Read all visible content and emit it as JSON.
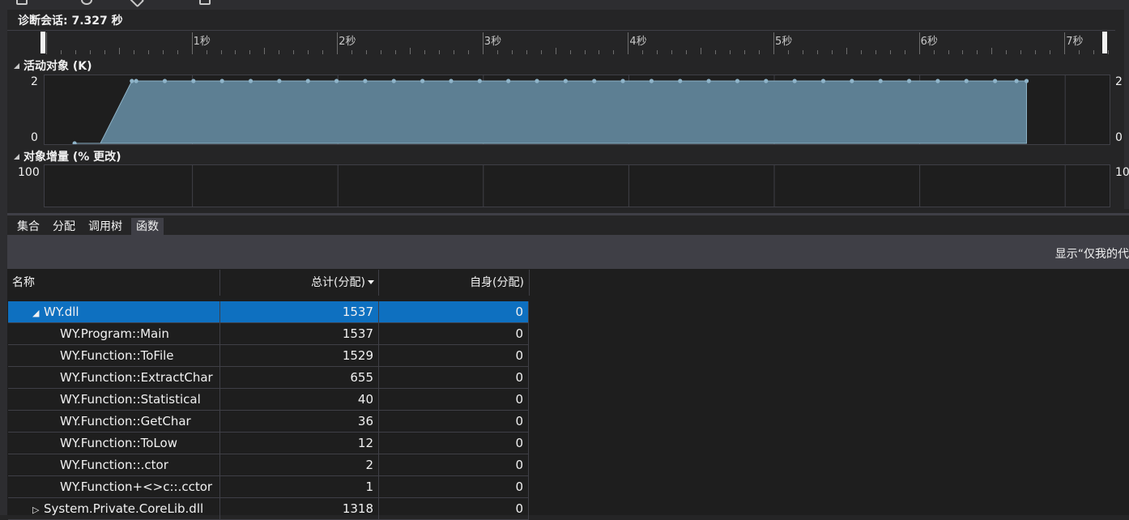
{
  "session": {
    "title": "诊断会话: 7.327 秒"
  },
  "ruler": {
    "labels": [
      "1秒",
      "2秒",
      "3秒",
      "4秒",
      "5秒",
      "6秒",
      "7秒"
    ]
  },
  "live_objects": {
    "title": "活动对象 (K)",
    "y_max_label": "2",
    "y_min_label": "0",
    "y_max_label_right": "2",
    "y_min_label_right": "0"
  },
  "object_diff": {
    "title": "对象增量 (% 更改)",
    "y_max_label": "100",
    "y_max_label_right": "10"
  },
  "tabs": [
    {
      "label": "集合",
      "active": false
    },
    {
      "label": "分配",
      "active": false
    },
    {
      "label": "调用树",
      "active": false
    },
    {
      "label": "函数",
      "active": true
    }
  ],
  "filter": {
    "label": "显示“仅我的代"
  },
  "table": {
    "headers": {
      "name": "名称",
      "total": "总计(分配)",
      "self": "自身(分配)"
    },
    "rows": [
      {
        "name": "WY.dll",
        "total": "1537",
        "self": "0",
        "level": 0,
        "expander": "◢",
        "selected": true
      },
      {
        "name": "WY.Program::Main",
        "total": "1537",
        "self": "0",
        "level": 1
      },
      {
        "name": "WY.Function::ToFile",
        "total": "1529",
        "self": "0",
        "level": 1
      },
      {
        "name": "WY.Function::ExtractChar",
        "total": "655",
        "self": "0",
        "level": 1
      },
      {
        "name": "WY.Function::Statistical",
        "total": "40",
        "self": "0",
        "level": 1
      },
      {
        "name": "WY.Function::GetChar",
        "total": "36",
        "self": "0",
        "level": 1
      },
      {
        "name": "WY.Function::ToLow",
        "total": "12",
        "self": "0",
        "level": 1
      },
      {
        "name": "WY.Function::.ctor",
        "total": "2",
        "self": "0",
        "level": 1
      },
      {
        "name": "WY.Function+<>c::.cctor",
        "total": "1",
        "self": "0",
        "level": 1
      },
      {
        "name": "System.Private.CoreLib.dll",
        "total": "1318",
        "self": "0",
        "level": 0,
        "expander": "▷"
      }
    ]
  },
  "chart_data": {
    "type": "area",
    "title": "活动对象 (K)",
    "xlabel": "",
    "ylabel": "",
    "x": [
      0.07,
      0.25,
      0.47,
      0.5,
      0.7,
      0.9,
      1.1,
      1.3,
      1.5,
      1.7,
      1.9,
      2.1,
      2.3,
      2.5,
      2.7,
      2.9,
      3.1,
      3.3,
      3.5,
      3.7,
      3.9,
      4.1,
      4.3,
      4.5,
      4.7,
      4.9,
      5.1,
      5.3,
      5.5,
      5.7,
      5.9,
      6.1,
      6.3,
      6.5,
      6.65,
      6.72
    ],
    "series": [
      {
        "values": [
          0,
          0,
          2,
          2,
          2,
          2,
          2,
          2,
          2,
          2,
          2,
          2,
          2,
          2,
          2,
          2,
          2,
          2,
          2,
          2,
          2,
          2,
          2,
          2,
          2,
          2,
          2,
          2,
          2,
          2,
          2,
          2,
          2,
          2,
          2,
          2
        ]
      }
    ],
    "xlim": [
      -0.14,
      7.3
    ],
    "ylim": [
      0,
      2
    ],
    "color": "#5d7f93",
    "marker_color": "#8fb4c9"
  }
}
